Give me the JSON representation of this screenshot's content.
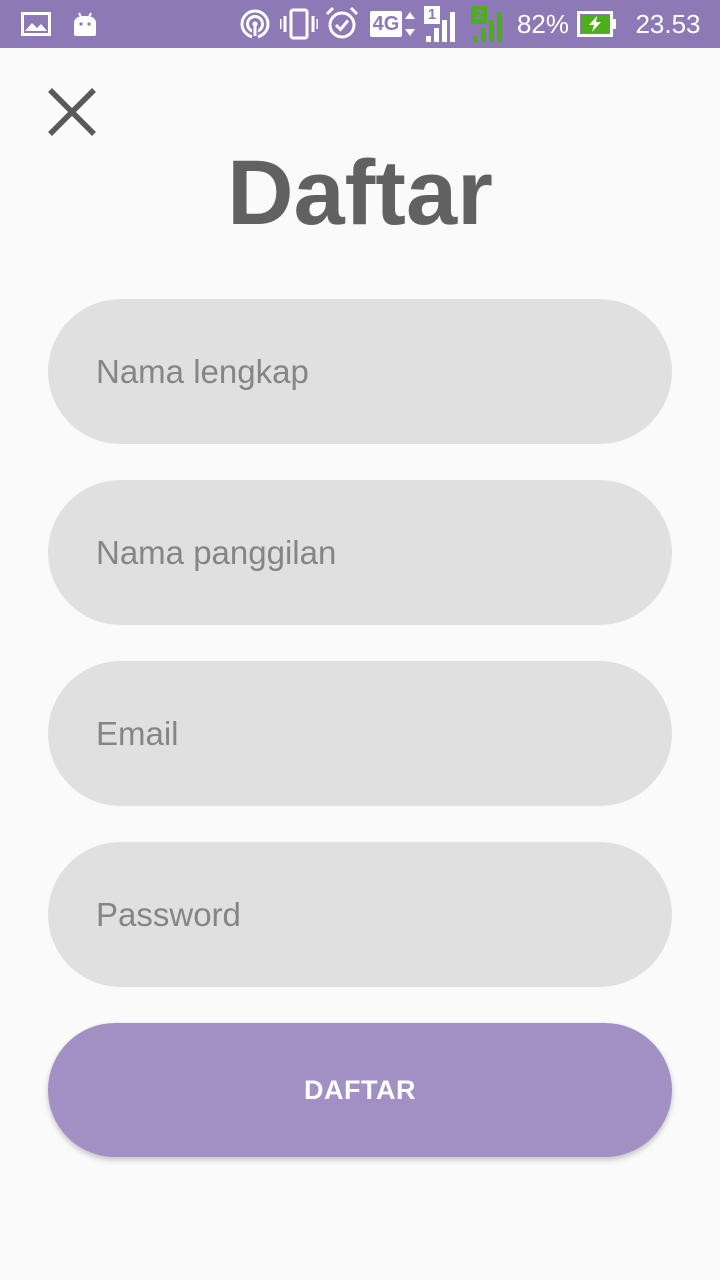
{
  "colors": {
    "status_bar": "#8e79b7",
    "background": "#fafafa",
    "field": "#e0e0e0",
    "placeholder": "#858585",
    "title": "#616161",
    "button": "#a290c5",
    "button_text": "#ffffff",
    "signal_green": "#4caf1a"
  },
  "status_bar": {
    "icons": [
      "image-notification-icon",
      "android-notification-icon",
      "hotspot-icon",
      "vibrate-icon",
      "alarm-icon",
      "network-4g-icon",
      "sim1-signal-icon",
      "sim2-signal-icon",
      "battery-charging-icon"
    ],
    "network_type": "4G",
    "sim1_label": "1",
    "sim2_label": "2",
    "battery_percent": "82%",
    "time": "23.53"
  },
  "header": {
    "close_icon": "close-icon",
    "title": "Daftar"
  },
  "form": {
    "full_name": {
      "placeholder": "Nama lengkap",
      "value": ""
    },
    "nickname": {
      "placeholder": "Nama panggilan",
      "value": ""
    },
    "email": {
      "placeholder": "Email",
      "value": ""
    },
    "password": {
      "placeholder": "Password",
      "value": ""
    },
    "submit_label": "DAFTAR"
  }
}
